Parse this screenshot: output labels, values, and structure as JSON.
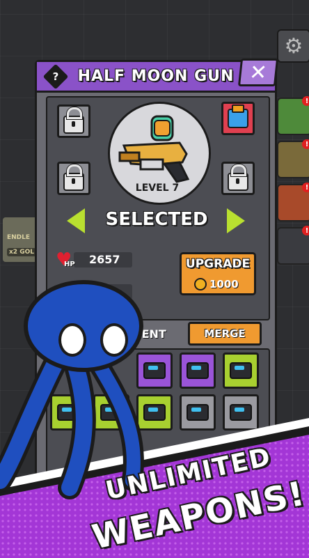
{
  "dialog": {
    "title": "HALF MOON GUN",
    "help_icon": "?",
    "close_icon": "✕",
    "weapon_level": "LEVEL 7",
    "selection_status": "SELECTED",
    "hp_label": "HP",
    "hp_value": "2657",
    "upgrade_label": "UPGRADE",
    "upgrade_cost": "1000",
    "equipment_label": "IPMENT",
    "merge_label": "MERGE"
  },
  "background": {
    "left_badge_line1": "ENDLE",
    "left_badge_line2": "x2 GOL",
    "right_alerts": [
      "!",
      "!",
      "!",
      "!"
    ]
  },
  "promo": {
    "line1": "UNLIMITED",
    "line2": "WEAPONS!"
  },
  "colors": {
    "title_bar": "#8a52c8",
    "accent_green": "#b9e030",
    "button_orange": "#f09a30",
    "promo_purple": "#a336d6",
    "stickman_blue": "#1f4fbf"
  },
  "icons": [
    "help-icon",
    "close-icon",
    "lock-icon",
    "gear-item-icon",
    "heart-icon",
    "coin-icon",
    "gun-icon",
    "settings-icon"
  ]
}
